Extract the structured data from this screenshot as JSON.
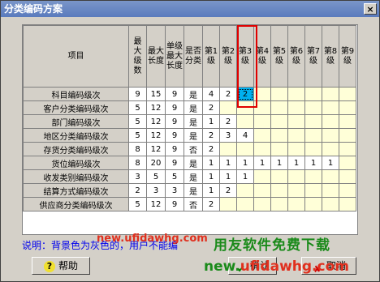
{
  "window": {
    "title": "分类编码方案",
    "close_label": "×"
  },
  "grid": {
    "headers": {
      "item": "项目",
      "max_levels": "最大级数",
      "max_length": "最大长度",
      "single_level_max": "单级最大长度",
      "is_category": "是否分类",
      "levels": [
        "第1级",
        "第2级",
        "第3级",
        "第4级",
        "第5级",
        "第6级",
        "第7级",
        "第8级",
        "第9级"
      ]
    },
    "rows": [
      {
        "item": "科目编码级次",
        "max_levels": "9",
        "max_length": "15",
        "single_max": "9",
        "is_cat": "是",
        "levels": [
          "4",
          "2",
          "2",
          "",
          "",
          "",
          "",
          "",
          ""
        ]
      },
      {
        "item": "客户分类编码级次",
        "max_levels": "5",
        "max_length": "12",
        "single_max": "9",
        "is_cat": "是",
        "levels": [
          "2",
          "",
          "",
          "",
          "",
          "",
          "",
          "",
          ""
        ]
      },
      {
        "item": "部门编码级次",
        "max_levels": "5",
        "max_length": "12",
        "single_max": "9",
        "is_cat": "是",
        "levels": [
          "1",
          "2",
          "",
          "",
          "",
          "",
          "",
          "",
          ""
        ]
      },
      {
        "item": "地区分类编码级次",
        "max_levels": "5",
        "max_length": "12",
        "single_max": "9",
        "is_cat": "是",
        "levels": [
          "2",
          "3",
          "4",
          "",
          "",
          "",
          "",
          "",
          ""
        ]
      },
      {
        "item": "存货分类编码级次",
        "max_levels": "8",
        "max_length": "12",
        "single_max": "9",
        "is_cat": "否",
        "levels": [
          "2",
          "",
          "",
          "",
          "",
          "",
          "",
          "",
          ""
        ]
      },
      {
        "item": "货位编码级次",
        "max_levels": "8",
        "max_length": "20",
        "single_max": "9",
        "is_cat": "是",
        "levels": [
          "1",
          "1",
          "1",
          "1",
          "1",
          "1",
          "1",
          "1",
          ""
        ]
      },
      {
        "item": "收发类别编码级次",
        "max_levels": "3",
        "max_length": "5",
        "single_max": "5",
        "is_cat": "是",
        "levels": [
          "1",
          "1",
          "1",
          "",
          "",
          "",
          "",
          "",
          ""
        ]
      },
      {
        "item": "结算方式编码级次",
        "max_levels": "2",
        "max_length": "3",
        "single_max": "3",
        "is_cat": "是",
        "levels": [
          "1",
          "2",
          "",
          "",
          "",
          "",
          "",
          "",
          ""
        ]
      },
      {
        "item": "供应商分类编码级次",
        "max_levels": "5",
        "max_length": "12",
        "single_max": "9",
        "is_cat": "否",
        "levels": [
          "2",
          "",
          "",
          "",
          "",
          "",
          "",
          "",
          ""
        ]
      }
    ]
  },
  "note": "说明：背景色为灰色的，用户不能编",
  "buttons": {
    "help": "帮助",
    "ok": "确认",
    "cancel": "取消"
  },
  "watermarks": {
    "url": "new.ufidawhg.com",
    "brand": "用友软件免费下载",
    "url2_a": "new.",
    "url2_b": "ufidawhg.com"
  },
  "colors": {
    "selected_cell": "#00b0f0",
    "empty_level": "#ffffd8",
    "highlight_box": "#e00000"
  }
}
